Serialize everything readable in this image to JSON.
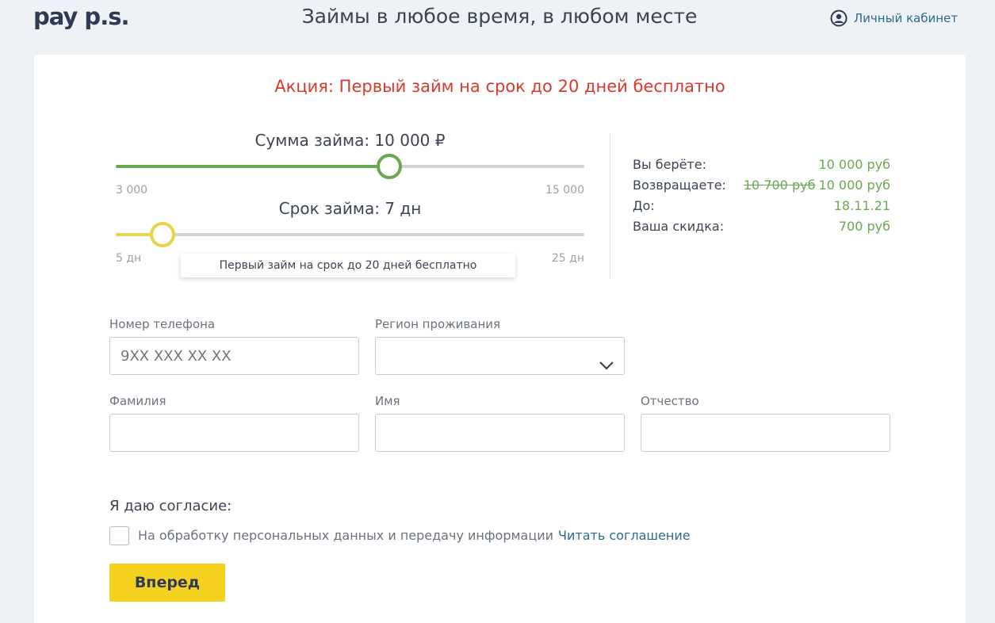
{
  "header": {
    "logo": "pay p.s.",
    "tagline": "Займы в любое время, в любом месте",
    "cabinet_label": "Личный кабинет"
  },
  "promo": "Акция: Первый займ на срок до 20 дней бесплатно",
  "amount_slider": {
    "title": "Сумма займа: 10 000 ₽",
    "min_label": "3 000",
    "max_label": "15 000",
    "value": 10000,
    "min": 3000,
    "max": 15000,
    "color": "#6aa84f"
  },
  "term_slider": {
    "title": "Срок займа: 7 дн",
    "min_label": "5 дн",
    "max_label": "25 дн",
    "value": 7,
    "min": 5,
    "max": 25,
    "color": "#e8d34a",
    "tooltip": "Первый займ на срок до 20 дней бесплатно"
  },
  "summary": {
    "take_label": "Вы берёте:",
    "take_value": "10 000 руб",
    "return_label": "Возвращаете:",
    "return_old": "10 700 руб",
    "return_value": "10 000 руб",
    "until_label": "До:",
    "until_value": "18.11.21",
    "discount_label": "Ваша скидка:",
    "discount_value": "700 руб"
  },
  "form": {
    "phone_label": "Номер телефона",
    "phone_placeholder": "9XX XXX XX XX",
    "region_label": "Регион проживания",
    "surname_label": "Фамилия",
    "name_label": "Имя",
    "patronymic_label": "Отчество"
  },
  "consent": {
    "title": "Я даю согласие:",
    "text": "На обработку персональных данных и передачу информации",
    "link": "Читать соглашение"
  },
  "submit_label": "Вперед"
}
